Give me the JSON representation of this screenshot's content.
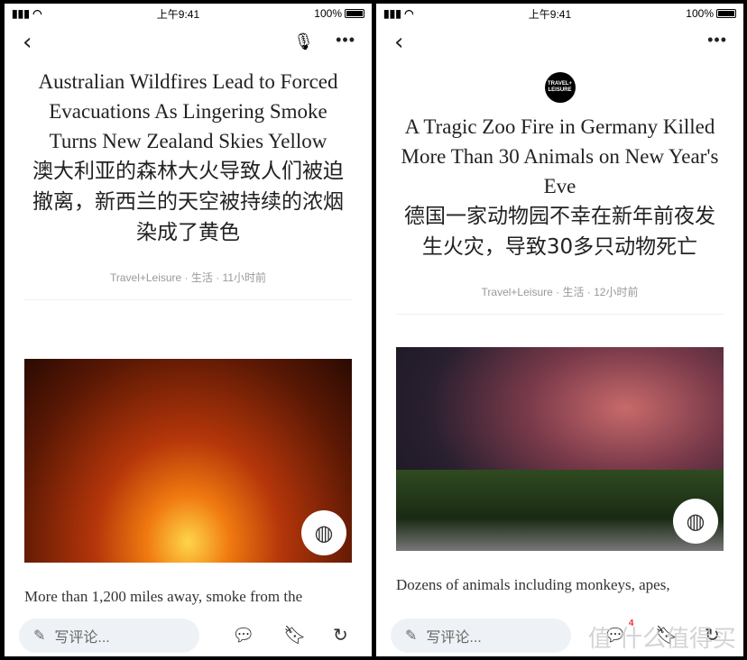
{
  "status": {
    "time": "上午9:41",
    "battery": "100%"
  },
  "left": {
    "title": "Australian Wildfires Lead to Forced Evacuations As Lingering Smoke Turns New Zealand Skies Yellow",
    "title_cn": "澳大利亚的森林大火导致人们被迫撤离，新西兰的天空被持续的浓烟染成了黄色",
    "meta": "Travel+Leisure · 生活 · 11小时前",
    "body": "More than 1,200 miles away, smoke from the",
    "comment_placeholder": "写评论..."
  },
  "right": {
    "logo": "TRAVEL+ LEISURE",
    "title": "A Tragic Zoo Fire in Germany Killed More Than 30 Animals on New Year's Eve",
    "title_cn": "德国一家动物园不幸在新年前夜发生火灾，导致30多只动物死亡",
    "meta": "Travel+Leisure · 生活 · 12小时前",
    "body": "Dozens of animals including monkeys, apes,",
    "comment_placeholder": "写评论...",
    "comment_count": "4",
    "watermark": "值 什么值得买"
  }
}
